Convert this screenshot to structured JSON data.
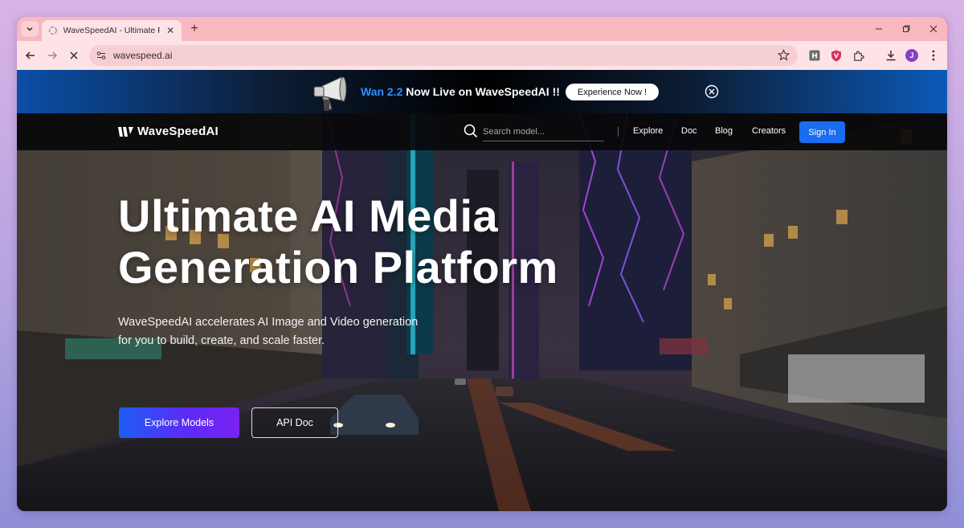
{
  "browser": {
    "tab": {
      "title": "WaveSpeedAI - Ultimate Platform"
    },
    "address": "wavespeed.ai",
    "profile_initial": "J",
    "extensions": [
      "h-extension-icon",
      "shield-extension-icon",
      "puzzle-extensions-icon"
    ]
  },
  "banner": {
    "highlight": "Wan 2.2",
    "text": "Now Live on WaveSpeedAI !!",
    "cta": "Experience Now !"
  },
  "site_nav": {
    "logo_text": "WaveSpeedAI",
    "search_placeholder": "Search model...",
    "links": [
      "Explore",
      "Doc",
      "Blog",
      "Creators"
    ],
    "signin": "Sign In"
  },
  "hero": {
    "title_line1": "Ultimate AI Media",
    "title_line2": "Generation Platform",
    "subtitle_line1": "WaveSpeedAI accelerates AI Image and Video generation",
    "subtitle_line2": "for you to build, create, and scale faster.",
    "primary_button": "Explore Models",
    "secondary_button": "API Doc"
  },
  "colors": {
    "accent_blue": "#1a6cf0",
    "highlight_blue": "#2f8fff",
    "tab_strip": "#f9b7bf",
    "toolbar": "#fde3e6"
  }
}
